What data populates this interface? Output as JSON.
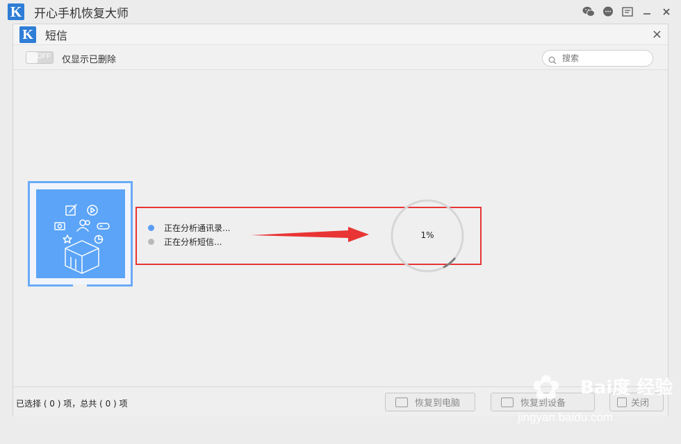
{
  "app": {
    "logo_letter": "K",
    "title": "开心手机恢复大师"
  },
  "panel": {
    "logo_letter": "K",
    "title": "短信",
    "close_label": "×"
  },
  "toolbar": {
    "toggle_label": "OFF",
    "show_deleted_label": "仅显示已删除",
    "search_placeholder": "搜索"
  },
  "status": {
    "items": [
      {
        "label": "正在分析通讯录...",
        "color": "#5b9cf7"
      },
      {
        "label": "正在分析短信...",
        "color": "#b9b9b9"
      }
    ],
    "progress_text": "1%",
    "progress_fraction": 0.01
  },
  "footer": {
    "selection_text": "已选择 ( 0 ) 项，总共 ( 0 ) 项",
    "restore_pc_label": "恢复到电脑",
    "restore_device_label": "恢复到设备",
    "close_label": "关闭"
  },
  "watermark": {
    "text": "Bai度 经验",
    "url": "jingyan.baidu.com"
  },
  "colors": {
    "accent": "#2f7dd6",
    "card_blue": "#5ba4f7",
    "highlight_red": "#e83434"
  }
}
